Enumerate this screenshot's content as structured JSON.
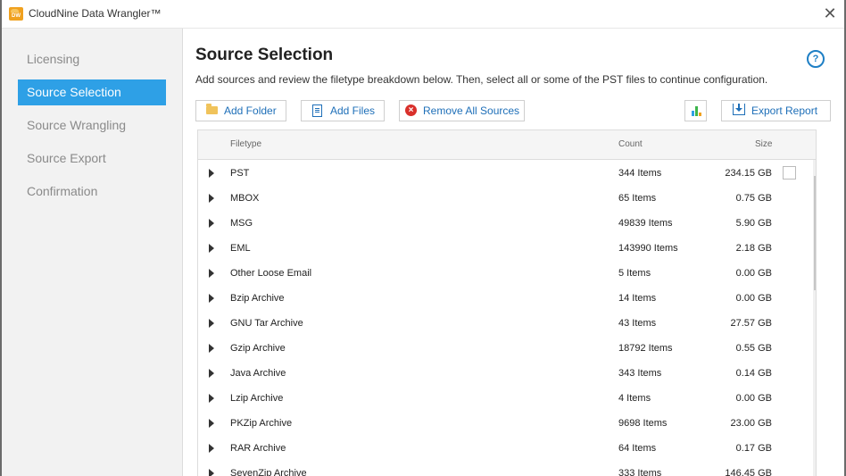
{
  "window": {
    "title": "CloudNine Data Wrangler™",
    "logo_text": "DW"
  },
  "sidebar": {
    "items": [
      {
        "label": "Licensing",
        "active": false
      },
      {
        "label": "Source Selection",
        "active": true
      },
      {
        "label": "Source Wrangling",
        "active": false
      },
      {
        "label": "Source Export",
        "active": false
      },
      {
        "label": "Confirmation",
        "active": false
      }
    ]
  },
  "main": {
    "title": "Source Selection",
    "subtitle": "Add sources and review the filetype breakdown below. Then, select all or some of the PST files to continue configuration.",
    "help_label": "?",
    "toolbar": {
      "add_folder": "Add Folder",
      "add_files": "Add Files",
      "remove_all": "Remove All Sources",
      "export_report": "Export Report"
    },
    "table": {
      "headers": {
        "filetype": "Filetype",
        "count": "Count",
        "size": "Size"
      },
      "rows": [
        {
          "filetype": "PST",
          "count": "344 Items",
          "size": "234.15 GB"
        },
        {
          "filetype": "MBOX",
          "count": "65 Items",
          "size": "0.75 GB"
        },
        {
          "filetype": "MSG",
          "count": "49839 Items",
          "size": "5.90 GB"
        },
        {
          "filetype": "EML",
          "count": "143990 Items",
          "size": "2.18 GB"
        },
        {
          "filetype": "Other Loose Email",
          "count": "5 Items",
          "size": "0.00 GB"
        },
        {
          "filetype": "Bzip Archive",
          "count": "14 Items",
          "size": "0.00 GB"
        },
        {
          "filetype": "GNU Tar Archive",
          "count": "43 Items",
          "size": "27.57 GB"
        },
        {
          "filetype": "Gzip Archive",
          "count": "18792 Items",
          "size": "0.55 GB"
        },
        {
          "filetype": "Java Archive",
          "count": "343 Items",
          "size": "0.14 GB"
        },
        {
          "filetype": "Lzip Archive",
          "count": "4 Items",
          "size": "0.00 GB"
        },
        {
          "filetype": "PKZip Archive",
          "count": "9698 Items",
          "size": "23.00 GB"
        },
        {
          "filetype": "RAR Archive",
          "count": "64 Items",
          "size": "0.17 GB"
        },
        {
          "filetype": "SevenZip Archive",
          "count": "333 Items",
          "size": "146.45 GB"
        }
      ]
    }
  },
  "colors": {
    "accent": "#2ea0e6",
    "link": "#1e6fb8",
    "danger": "#d9302b",
    "folder": "#f0c35b"
  }
}
